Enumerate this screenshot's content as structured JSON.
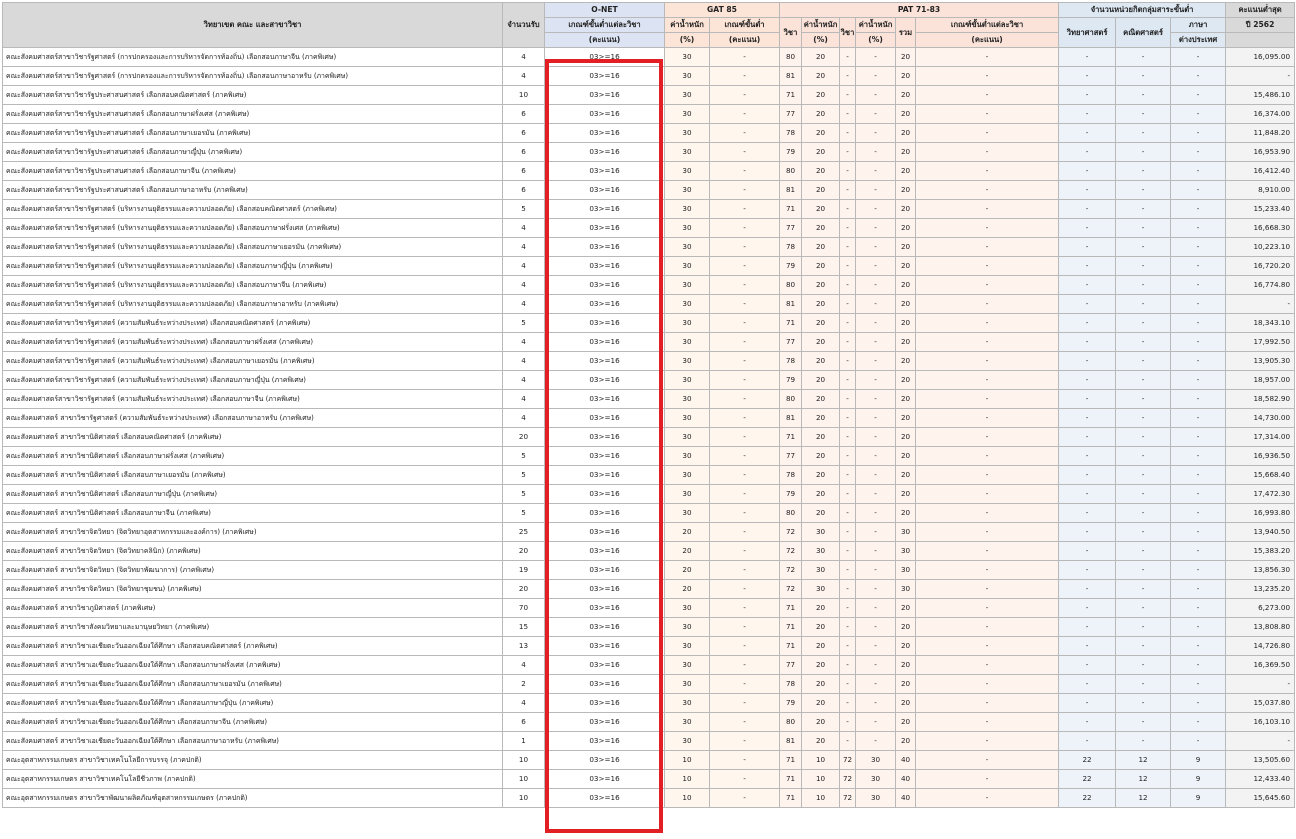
{
  "headers": {
    "program": "วิทยาเขต คณะ และสาขาวิชา",
    "seats": "จำนวนรับ",
    "onet_group": "O-NET",
    "onet_min": "เกณฑ์ขั้นต่ำแต่ละวิชา",
    "onet_min_unit": "(คะแนน)",
    "gat_group": "GAT 85",
    "gat_weight": "ค่าน้ำหนัก",
    "gat_weight_unit": "(%)",
    "gat_min": "เกณฑ์ขั้นต่ำ",
    "gat_min_unit": "(คะแนน)",
    "pat_group": "PAT 71-83",
    "pat_subject1": "วิชา",
    "pat_weight1": "ค่าน้ำหนัก",
    "pat_weight1_unit": "(%)",
    "pat_subject2": "วิชา",
    "pat_weight2": "ค่าน้ำหนัก",
    "pat_weight2_unit": "(%)",
    "pat_total": "รวม",
    "pat_min": "เกณฑ์ขั้นต่ำแต่ละวิชา",
    "pat_min_unit": "(คะแนน)",
    "credits_group": "จำนวนหน่วยกิตกลุ่มสาระขั้นต่ำ",
    "credits_sci": "วิทยาศาสตร์",
    "credits_math": "คณิตศาสตร์",
    "credits_lang": "ภาษา",
    "credits_lang2": "ต่างประเทศ",
    "max_score": "คะแนนต่ำสุด",
    "max_score_year": "ปี 2562"
  },
  "rows": [
    {
      "program": "คณะสังคมศาสตร์สาขาวิชารัฐศาสตร์ (การปกครองและการบริหารจัดการท้องถิ่น) เลือกสอบภาษาจีน (ภาคพิเศษ)",
      "seats": "4",
      "onet": "03>=16",
      "gat_w": "30",
      "gat_min": "-",
      "pat_s1": "80",
      "pat_w1": "20",
      "pat_s2": "-",
      "pat_w2": "-",
      "pat_total": "20",
      "pat_min": "-",
      "sci": "-",
      "math": "-",
      "lang": "-",
      "score": "16,095.00"
    },
    {
      "program": "คณะสังคมศาสตร์สาขาวิชารัฐศาสตร์ (การปกครองและการบริหารจัดการท้องถิ่น) เลือกสอบภาษาอาหรับ (ภาคพิเศษ)",
      "seats": "4",
      "onet": "03>=16",
      "gat_w": "30",
      "gat_min": "-",
      "pat_s1": "81",
      "pat_w1": "20",
      "pat_s2": "-",
      "pat_w2": "-",
      "pat_total": "20",
      "pat_min": "-",
      "sci": "-",
      "math": "-",
      "lang": "-",
      "score": "-"
    },
    {
      "program": "คณะสังคมศาสตร์สาขาวิชารัฐประศาสนศาสตร์ เลือกสอบคณิตศาสตร์ (ภาคพิเศษ)",
      "seats": "10",
      "onet": "03>=16",
      "gat_w": "30",
      "gat_min": "-",
      "pat_s1": "71",
      "pat_w1": "20",
      "pat_s2": "-",
      "pat_w2": "-",
      "pat_total": "20",
      "pat_min": "-",
      "sci": "-",
      "math": "-",
      "lang": "-",
      "score": "15,486.10"
    },
    {
      "program": "คณะสังคมศาสตร์สาขาวิชารัฐประศาสนศาสตร์ เลือกสอบภาษาฝรั่งเศส (ภาคพิเศษ)",
      "seats": "6",
      "onet": "03>=16",
      "gat_w": "30",
      "gat_min": "-",
      "pat_s1": "77",
      "pat_w1": "20",
      "pat_s2": "-",
      "pat_w2": "-",
      "pat_total": "20",
      "pat_min": "-",
      "sci": "-",
      "math": "-",
      "lang": "-",
      "score": "16,374.00"
    },
    {
      "program": "คณะสังคมศาสตร์สาขาวิชารัฐประศาสนศาสตร์ เลือกสอบภาษาเยอรมัน (ภาคพิเศษ)",
      "seats": "6",
      "onet": "03>=16",
      "gat_w": "30",
      "gat_min": "-",
      "pat_s1": "78",
      "pat_w1": "20",
      "pat_s2": "-",
      "pat_w2": "-",
      "pat_total": "20",
      "pat_min": "-",
      "sci": "-",
      "math": "-",
      "lang": "-",
      "score": "11,848.20"
    },
    {
      "program": "คณะสังคมศาสตร์สาขาวิชารัฐประศาสนศาสตร์ เลือกสอบภาษาญี่ปุ่น (ภาคพิเศษ)",
      "seats": "6",
      "onet": "03>=16",
      "gat_w": "30",
      "gat_min": "-",
      "pat_s1": "79",
      "pat_w1": "20",
      "pat_s2": "-",
      "pat_w2": "-",
      "pat_total": "20",
      "pat_min": "-",
      "sci": "-",
      "math": "-",
      "lang": "-",
      "score": "16,953.90"
    },
    {
      "program": "คณะสังคมศาสตร์สาขาวิชารัฐประศาสนศาสตร์ เลือกสอบภาษาจีน (ภาคพิเศษ)",
      "seats": "6",
      "onet": "03>=16",
      "gat_w": "30",
      "gat_min": "-",
      "pat_s1": "80",
      "pat_w1": "20",
      "pat_s2": "-",
      "pat_w2": "-",
      "pat_total": "20",
      "pat_min": "-",
      "sci": "-",
      "math": "-",
      "lang": "-",
      "score": "16,412.40"
    },
    {
      "program": "คณะสังคมศาสตร์สาขาวิชารัฐประศาสนศาสตร์ เลือกสอบภาษาอาหรับ (ภาคพิเศษ)",
      "seats": "6",
      "onet": "03>=16",
      "gat_w": "30",
      "gat_min": "-",
      "pat_s1": "81",
      "pat_w1": "20",
      "pat_s2": "-",
      "pat_w2": "-",
      "pat_total": "20",
      "pat_min": "-",
      "sci": "-",
      "math": "-",
      "lang": "-",
      "score": "8,910.00"
    },
    {
      "program": "คณะสังคมศาสตร์สาขาวิชารัฐศาสตร์ (บริหารงานยุติธรรมและความปลอดภัย) เลือกสอบคณิตศาสตร์ (ภาคพิเศษ)",
      "seats": "5",
      "onet": "03>=16",
      "gat_w": "30",
      "gat_min": "-",
      "pat_s1": "71",
      "pat_w1": "20",
      "pat_s2": "-",
      "pat_w2": "-",
      "pat_total": "20",
      "pat_min": "-",
      "sci": "-",
      "math": "-",
      "lang": "-",
      "score": "15,233.40"
    },
    {
      "program": "คณะสังคมศาสตร์สาขาวิชารัฐศาสตร์ (บริหารงานยุติธรรมและความปลอดภัย) เลือกสอบภาษาฝรั่งเศส (ภาคพิเศษ)",
      "seats": "4",
      "onet": "03>=16",
      "gat_w": "30",
      "gat_min": "-",
      "pat_s1": "77",
      "pat_w1": "20",
      "pat_s2": "-",
      "pat_w2": "-",
      "pat_total": "20",
      "pat_min": "-",
      "sci": "-",
      "math": "-",
      "lang": "-",
      "score": "16,668.30"
    },
    {
      "program": "คณะสังคมศาสตร์สาขาวิชารัฐศาสตร์ (บริหารงานยุติธรรมและความปลอดภัย) เลือกสอบภาษาเยอรมัน (ภาคพิเศษ)",
      "seats": "4",
      "onet": "03>=16",
      "gat_w": "30",
      "gat_min": "-",
      "pat_s1": "78",
      "pat_w1": "20",
      "pat_s2": "-",
      "pat_w2": "-",
      "pat_total": "20",
      "pat_min": "-",
      "sci": "-",
      "math": "-",
      "lang": "-",
      "score": "10,223.10"
    },
    {
      "program": "คณะสังคมศาสตร์สาขาวิชารัฐศาสตร์ (บริหารงานยุติธรรมและความปลอดภัย) เลือกสอบภาษาญี่ปุ่น (ภาคพิเศษ)",
      "seats": "4",
      "onet": "03>=16",
      "gat_w": "30",
      "gat_min": "-",
      "pat_s1": "79",
      "pat_w1": "20",
      "pat_s2": "-",
      "pat_w2": "-",
      "pat_total": "20",
      "pat_min": "-",
      "sci": "-",
      "math": "-",
      "lang": "-",
      "score": "16,720.20"
    },
    {
      "program": "คณะสังคมศาสตร์สาขาวิชารัฐศาสตร์ (บริหารงานยุติธรรมและความปลอดภัย) เลือกสอบภาษาจีน (ภาคพิเศษ)",
      "seats": "4",
      "onet": "03>=16",
      "gat_w": "30",
      "gat_min": "-",
      "pat_s1": "80",
      "pat_w1": "20",
      "pat_s2": "-",
      "pat_w2": "-",
      "pat_total": "20",
      "pat_min": "-",
      "sci": "-",
      "math": "-",
      "lang": "-",
      "score": "16,774.80"
    },
    {
      "program": "คณะสังคมศาสตร์สาขาวิชารัฐศาสตร์ (บริหารงานยุติธรรมและความปลอดภัย) เลือกสอบภาษาอาหรับ (ภาคพิเศษ)",
      "seats": "4",
      "onet": "03>=16",
      "gat_w": "30",
      "gat_min": "-",
      "pat_s1": "81",
      "pat_w1": "20",
      "pat_s2": "-",
      "pat_w2": "-",
      "pat_total": "20",
      "pat_min": "-",
      "sci": "-",
      "math": "-",
      "lang": "-",
      "score": "-"
    },
    {
      "program": "คณะสังคมศาสตร์สาขาวิชารัฐศาสตร์ (ความสัมพันธ์ระหว่างประเทศ) เลือกสอบคณิตศาสตร์ (ภาคพิเศษ)",
      "seats": "5",
      "onet": "03>=16",
      "gat_w": "30",
      "gat_min": "-",
      "pat_s1": "71",
      "pat_w1": "20",
      "pat_s2": "-",
      "pat_w2": "-",
      "pat_total": "20",
      "pat_min": "-",
      "sci": "-",
      "math": "-",
      "lang": "-",
      "score": "18,343.10"
    },
    {
      "program": "คณะสังคมศาสตร์สาขาวิชารัฐศาสตร์ (ความสัมพันธ์ระหว่างประเทศ) เลือกสอบภาษาฝรั่งเศส (ภาคพิเศษ)",
      "seats": "4",
      "onet": "03>=16",
      "gat_w": "30",
      "gat_min": "-",
      "pat_s1": "77",
      "pat_w1": "20",
      "pat_s2": "-",
      "pat_w2": "-",
      "pat_total": "20",
      "pat_min": "-",
      "sci": "-",
      "math": "-",
      "lang": "-",
      "score": "17,992.50"
    },
    {
      "program": "คณะสังคมศาสตร์สาขาวิชารัฐศาสตร์ (ความสัมพันธ์ระหว่างประเทศ) เลือกสอบภาษาเยอรมัน (ภาคพิเศษ)",
      "seats": "4",
      "onet": "03>=16",
      "gat_w": "30",
      "gat_min": "-",
      "pat_s1": "78",
      "pat_w1": "20",
      "pat_s2": "-",
      "pat_w2": "-",
      "pat_total": "20",
      "pat_min": "-",
      "sci": "-",
      "math": "-",
      "lang": "-",
      "score": "13,905.30"
    },
    {
      "program": "คณะสังคมศาสตร์สาขาวิชารัฐศาสตร์ (ความสัมพันธ์ระหว่างประเทศ) เลือกสอบภาษาญี่ปุ่น (ภาคพิเศษ)",
      "seats": "4",
      "onet": "03>=16",
      "gat_w": "30",
      "gat_min": "-",
      "pat_s1": "79",
      "pat_w1": "20",
      "pat_s2": "-",
      "pat_w2": "-",
      "pat_total": "20",
      "pat_min": "-",
      "sci": "-",
      "math": "-",
      "lang": "-",
      "score": "18,957.00"
    },
    {
      "program": "คณะสังคมศาสตร์สาขาวิชารัฐศาสตร์ (ความสัมพันธ์ระหว่างประเทศ) เลือกสอบภาษาจีน (ภาคพิเศษ)",
      "seats": "4",
      "onet": "03>=16",
      "gat_w": "30",
      "gat_min": "-",
      "pat_s1": "80",
      "pat_w1": "20",
      "pat_s2": "-",
      "pat_w2": "-",
      "pat_total": "20",
      "pat_min": "-",
      "sci": "-",
      "math": "-",
      "lang": "-",
      "score": "18,582.90"
    },
    {
      "program": "คณะสังคมศาสตร์ สาขาวิชารัฐศาสตร์ (ความสัมพันธ์ระหว่างประเทศ) เลือกสอบภาษาอาหรับ (ภาคพิเศษ)",
      "seats": "4",
      "onet": "03>=16",
      "gat_w": "30",
      "gat_min": "-",
      "pat_s1": "81",
      "pat_w1": "20",
      "pat_s2": "-",
      "pat_w2": "-",
      "pat_total": "20",
      "pat_min": "-",
      "sci": "-",
      "math": "-",
      "lang": "-",
      "score": "14,730.00"
    },
    {
      "program": "คณะสังคมศาสตร์ สาขาวิชานิติศาสตร์ เลือกสอบคณิตศาสตร์ (ภาคพิเศษ)",
      "seats": "20",
      "onet": "03>=16",
      "gat_w": "30",
      "gat_min": "-",
      "pat_s1": "71",
      "pat_w1": "20",
      "pat_s2": "-",
      "pat_w2": "-",
      "pat_total": "20",
      "pat_min": "-",
      "sci": "-",
      "math": "-",
      "lang": "-",
      "score": "17,314.00"
    },
    {
      "program": "คณะสังคมศาสตร์ สาขาวิชานิติศาสตร์ เลือกสอบภาษาฝรั่งเศส (ภาคพิเศษ)",
      "seats": "5",
      "onet": "03>=16",
      "gat_w": "30",
      "gat_min": "-",
      "pat_s1": "77",
      "pat_w1": "20",
      "pat_s2": "-",
      "pat_w2": "-",
      "pat_total": "20",
      "pat_min": "-",
      "sci": "-",
      "math": "-",
      "lang": "-",
      "score": "16,936.50"
    },
    {
      "program": "คณะสังคมศาสตร์ สาขาวิชานิติศาสตร์ เลือกสอบภาษาเยอรมัน (ภาคพิเศษ)",
      "seats": "5",
      "onet": "03>=16",
      "gat_w": "30",
      "gat_min": "-",
      "pat_s1": "78",
      "pat_w1": "20",
      "pat_s2": "-",
      "pat_w2": "-",
      "pat_total": "20",
      "pat_min": "-",
      "sci": "-",
      "math": "-",
      "lang": "-",
      "score": "15,668.40"
    },
    {
      "program": "คณะสังคมศาสตร์ สาขาวิชานิติศาสตร์ เลือกสอบภาษาญี่ปุ่น (ภาคพิเศษ)",
      "seats": "5",
      "onet": "03>=16",
      "gat_w": "30",
      "gat_min": "-",
      "pat_s1": "79",
      "pat_w1": "20",
      "pat_s2": "-",
      "pat_w2": "-",
      "pat_total": "20",
      "pat_min": "-",
      "sci": "-",
      "math": "-",
      "lang": "-",
      "score": "17,472.30"
    },
    {
      "program": "คณะสังคมศาสตร์ สาขาวิชานิติศาสตร์ เลือกสอบภาษาจีน (ภาคพิเศษ)",
      "seats": "5",
      "onet": "03>=16",
      "gat_w": "30",
      "gat_min": "-",
      "pat_s1": "80",
      "pat_w1": "20",
      "pat_s2": "-",
      "pat_w2": "-",
      "pat_total": "20",
      "pat_min": "-",
      "sci": "-",
      "math": "-",
      "lang": "-",
      "score": "16,993.80"
    },
    {
      "program": "คณะสังคมศาสตร์ สาขาวิชาจิตวิทยา (จิตวิทยาอุตสาหกรรมและองค์การ) (ภาคพิเศษ)",
      "seats": "25",
      "onet": "03>=16",
      "gat_w": "20",
      "gat_min": "-",
      "pat_s1": "72",
      "pat_w1": "30",
      "pat_s2": "-",
      "pat_w2": "-",
      "pat_total": "30",
      "pat_min": "-",
      "sci": "-",
      "math": "-",
      "lang": "-",
      "score": "13,940.50"
    },
    {
      "program": "คณะสังคมศาสตร์ สาขาวิชาจิตวิทยา (จิตวิทยาคลินิก) (ภาคพิเศษ)",
      "seats": "20",
      "onet": "03>=16",
      "gat_w": "20",
      "gat_min": "-",
      "pat_s1": "72",
      "pat_w1": "30",
      "pat_s2": "-",
      "pat_w2": "-",
      "pat_total": "30",
      "pat_min": "-",
      "sci": "-",
      "math": "-",
      "lang": "-",
      "score": "15,383.20"
    },
    {
      "program": "คณะสังคมศาสตร์ สาขาวิชาจิตวิทยา (จิตวิทยาพัฒนาการ) (ภาคพิเศษ)",
      "seats": "19",
      "onet": "03>=16",
      "gat_w": "20",
      "gat_min": "-",
      "pat_s1": "72",
      "pat_w1": "30",
      "pat_s2": "-",
      "pat_w2": "-",
      "pat_total": "30",
      "pat_min": "-",
      "sci": "-",
      "math": "-",
      "lang": "-",
      "score": "13,856.30"
    },
    {
      "program": "คณะสังคมศาสตร์ สาขาวิชาจิตวิทยา (จิตวิทยาชุมชน) (ภาคพิเศษ)",
      "seats": "20",
      "onet": "03>=16",
      "gat_w": "20",
      "gat_min": "-",
      "pat_s1": "72",
      "pat_w1": "30",
      "pat_s2": "-",
      "pat_w2": "-",
      "pat_total": "30",
      "pat_min": "-",
      "sci": "-",
      "math": "-",
      "lang": "-",
      "score": "13,235.20"
    },
    {
      "program": "คณะสังคมศาสตร์ สาขาวิชาภูมิศาสตร์ (ภาคพิเศษ)",
      "seats": "70",
      "onet": "03>=16",
      "gat_w": "30",
      "gat_min": "-",
      "pat_s1": "71",
      "pat_w1": "20",
      "pat_s2": "-",
      "pat_w2": "-",
      "pat_total": "20",
      "pat_min": "-",
      "sci": "-",
      "math": "-",
      "lang": "-",
      "score": "6,273.00"
    },
    {
      "program": "คณะสังคมศาสตร์ สาขาวิชาสังคมวิทยาและมานุษยวิทยา (ภาคพิเศษ)",
      "seats": "15",
      "onet": "03>=16",
      "gat_w": "30",
      "gat_min": "-",
      "pat_s1": "71",
      "pat_w1": "20",
      "pat_s2": "-",
      "pat_w2": "-",
      "pat_total": "20",
      "pat_min": "-",
      "sci": "-",
      "math": "-",
      "lang": "-",
      "score": "13,808.80"
    },
    {
      "program": "คณะสังคมศาสตร์ สาขาวิชาเอเชียตะวันออกเฉียงใต้ศึกษา เลือกสอบคณิตศาสตร์ (ภาคพิเศษ)",
      "seats": "13",
      "onet": "03>=16",
      "gat_w": "30",
      "gat_min": "-",
      "pat_s1": "71",
      "pat_w1": "20",
      "pat_s2": "-",
      "pat_w2": "-",
      "pat_total": "20",
      "pat_min": "-",
      "sci": "-",
      "math": "-",
      "lang": "-",
      "score": "14,726.80"
    },
    {
      "program": "คณะสังคมศาสตร์ สาขาวิชาเอเชียตะวันออกเฉียงใต้ศึกษา เลือกสอบภาษาฝรั่งเศส (ภาคพิเศษ)",
      "seats": "4",
      "onet": "03>=16",
      "gat_w": "30",
      "gat_min": "-",
      "pat_s1": "77",
      "pat_w1": "20",
      "pat_s2": "-",
      "pat_w2": "-",
      "pat_total": "20",
      "pat_min": "-",
      "sci": "-",
      "math": "-",
      "lang": "-",
      "score": "16,369.50"
    },
    {
      "program": "คณะสังคมศาสตร์ สาขาวิชาเอเชียตะวันออกเฉียงใต้ศึกษา เลือกสอบภาษาเยอรมัน (ภาคพิเศษ)",
      "seats": "2",
      "onet": "03>=16",
      "gat_w": "30",
      "gat_min": "-",
      "pat_s1": "78",
      "pat_w1": "20",
      "pat_s2": "-",
      "pat_w2": "-",
      "pat_total": "20",
      "pat_min": "-",
      "sci": "-",
      "math": "-",
      "lang": "-",
      "score": "-"
    },
    {
      "program": "คณะสังคมศาสตร์ สาขาวิชาเอเชียตะวันออกเฉียงใต้ศึกษา เลือกสอบภาษาญี่ปุ่น (ภาคพิเศษ)",
      "seats": "4",
      "onet": "03>=16",
      "gat_w": "30",
      "gat_min": "-",
      "pat_s1": "79",
      "pat_w1": "20",
      "pat_s2": "-",
      "pat_w2": "-",
      "pat_total": "20",
      "pat_min": "-",
      "sci": "-",
      "math": "-",
      "lang": "-",
      "score": "15,037.80"
    },
    {
      "program": "คณะสังคมศาสตร์ สาขาวิชาเอเชียตะวันออกเฉียงใต้ศึกษา เลือกสอบภาษาจีน (ภาคพิเศษ)",
      "seats": "6",
      "onet": "03>=16",
      "gat_w": "30",
      "gat_min": "-",
      "pat_s1": "80",
      "pat_w1": "20",
      "pat_s2": "-",
      "pat_w2": "-",
      "pat_total": "20",
      "pat_min": "-",
      "sci": "-",
      "math": "-",
      "lang": "-",
      "score": "16,103.10"
    },
    {
      "program": "คณะสังคมศาสตร์ สาขาวิชาเอเชียตะวันออกเฉียงใต้ศึกษา เลือกสอบภาษาอาหรับ (ภาคพิเศษ)",
      "seats": "1",
      "onet": "03>=16",
      "gat_w": "30",
      "gat_min": "-",
      "pat_s1": "81",
      "pat_w1": "20",
      "pat_s2": "-",
      "pat_w2": "-",
      "pat_total": "20",
      "pat_min": "-",
      "sci": "-",
      "math": "-",
      "lang": "-",
      "score": "-"
    },
    {
      "program": "คณะอุตสาหกรรมเกษตร สาขาวิชาเทคโนโลยีการบรรจุ (ภาคปกติ)",
      "seats": "10",
      "onet": "03>=16",
      "gat_w": "10",
      "gat_min": "-",
      "pat_s1": "71",
      "pat_w1": "10",
      "pat_s2": "72",
      "pat_w2": "30",
      "pat_total": "40",
      "pat_min": "-",
      "sci": "22",
      "math": "12",
      "lang": "9",
      "score": "13,505.60"
    },
    {
      "program": "คณะอุตสาหกรรมเกษตร สาขาวิชาเทคโนโลยีชีวภาพ (ภาคปกติ)",
      "seats": "10",
      "onet": "03>=16",
      "gat_w": "10",
      "gat_min": "-",
      "pat_s1": "71",
      "pat_w1": "10",
      "pat_s2": "72",
      "pat_w2": "30",
      "pat_total": "40",
      "pat_min": "-",
      "sci": "22",
      "math": "12",
      "lang": "9",
      "score": "12,433.40"
    },
    {
      "program": "คณะอุตสาหกรรมเกษตร สาขาวิชาพัฒนาผลิตภัณฑ์อุตสาหกรรมเกษตร (ภาคปกติ)",
      "seats": "10",
      "onet": "03>=16",
      "gat_w": "10",
      "gat_min": "-",
      "pat_s1": "71",
      "pat_w1": "10",
      "pat_s2": "72",
      "pat_w2": "30",
      "pat_total": "40",
      "pat_min": "-",
      "sci": "22",
      "math": "12",
      "lang": "9",
      "score": "15,645.60"
    }
  ]
}
